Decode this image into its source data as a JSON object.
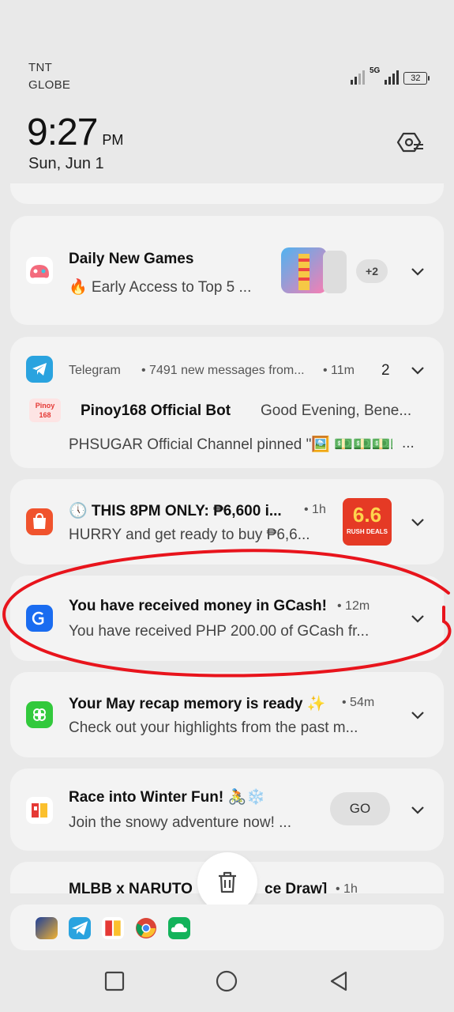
{
  "status_bar": {
    "carrier_1": "TNT",
    "carrier_2": "GLOBE",
    "network": "5G",
    "battery": "32"
  },
  "clock": {
    "time": "9:27",
    "ampm": "PM",
    "date": "Sun, Jun 1"
  },
  "notifications": [
    {
      "title": "Daily New Games",
      "body": "🔥 Early Access to Top 5 ...",
      "more_badge": "+2"
    },
    {
      "app": "Telegram",
      "summary": "• 7491 new messages from...",
      "time": "• 11m",
      "count": "2",
      "sender_icon_text": "Pinoy 168",
      "sender": "Pinoy168 Official Bot",
      "sender_message": "Good Evening, Bene...",
      "body": "PHSUGAR Official Channel pinned \"🖼️ 💵💵💵💵",
      "body_ellipsis": "..."
    },
    {
      "title": "🕔 THIS 8PM ONLY: ₱6,600 i...",
      "time": "• 1h",
      "body": "HURRY and get ready to buy ₱6,6...",
      "thumb_big": "6.6",
      "thumb_small": "RUSH DEALS"
    },
    {
      "title": "You have received money in GCash!",
      "time": "• 12m",
      "body": "You have received PHP 200.00 of GCash fr..."
    },
    {
      "title": "Your May recap memory is ready ✨",
      "time": "• 54m",
      "body": "Check out your highlights from the past m..."
    },
    {
      "title": "Race into Winter Fun! 🚴❄️",
      "body": "Join the snowy adventure now! ...",
      "action": "GO"
    },
    {
      "title": "MLBB x NARUTO",
      "title_tail": "ce Draw]",
      "time": "• 1h"
    }
  ],
  "dock": {
    "items": [
      "phl-game-icon",
      "telegram-icon",
      "phl-app-icon",
      "chrome-icon",
      "cloud-icon"
    ]
  },
  "colors": {
    "background": "#e9e9e9",
    "card": "#f3f3f3",
    "annotation_red": "#e8141c",
    "telegram": "#2aa3df",
    "gcash": "#1a6cf0",
    "shopee": "#f0532d"
  }
}
